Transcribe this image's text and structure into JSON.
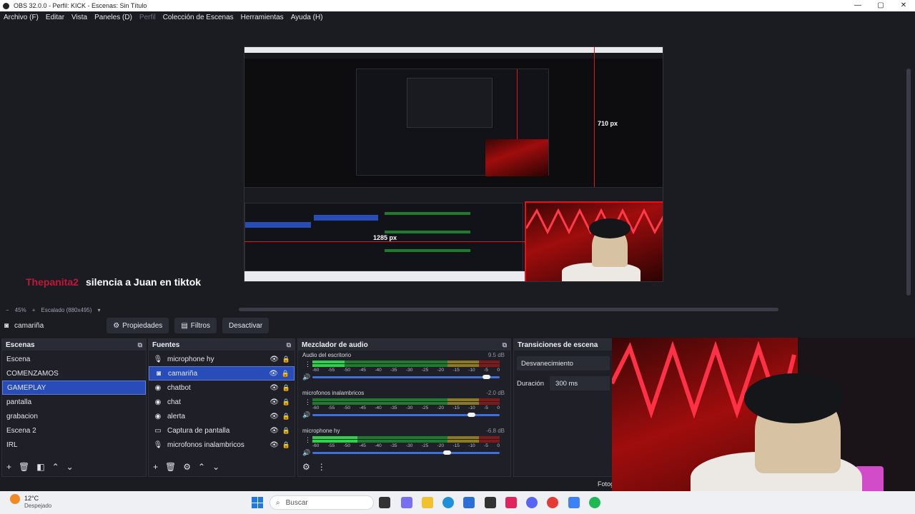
{
  "window": {
    "title": "OBS 32.0.0 - Perfil: KICK - Escenas: Sin Título",
    "controls": [
      "—",
      "▢",
      "✕"
    ]
  },
  "menu": [
    {
      "label": "Archivo (F)",
      "disabled": false
    },
    {
      "label": "Editar",
      "disabled": false
    },
    {
      "label": "Vista",
      "disabled": false
    },
    {
      "label": "Paneles (D)",
      "disabled": false
    },
    {
      "label": "Perfil",
      "disabled": true
    },
    {
      "label": "Colección de Escenas",
      "disabled": false
    },
    {
      "label": "Herramientas",
      "disabled": false
    },
    {
      "label": "Ayuda (H)",
      "disabled": false
    }
  ],
  "preview": {
    "caption_user": "Thepanita2",
    "caption_msg": "silencia a Juan en tiktok",
    "height_label": "710 px",
    "width_label": "1285 px"
  },
  "zoom": {
    "minus": "−",
    "percent": "45%",
    "plus": "+",
    "scale": "Escalado (880x495)"
  },
  "source_toolbar": {
    "selected_source": "camariña",
    "properties": "Propiedades",
    "filters": "Filtros",
    "deactivate": "Desactivar"
  },
  "scenes": {
    "title": "Escenas",
    "items": [
      "Escena",
      "COMENZAMOS",
      "GAMEPLAY",
      "pantalla",
      "grabacion",
      "Escena 2",
      "IRL"
    ],
    "selected": "GAMEPLAY"
  },
  "sources": {
    "title": "Fuentes",
    "items": [
      {
        "name": "microphone hy",
        "icon": "mic-icon"
      },
      {
        "name": "camariña",
        "icon": "camera-icon"
      },
      {
        "name": "chatbot",
        "icon": "browser-icon"
      },
      {
        "name": "chat",
        "icon": "browser-icon"
      },
      {
        "name": "alerta",
        "icon": "browser-icon"
      },
      {
        "name": "Captura de pantalla",
        "icon": "monitor-icon"
      },
      {
        "name": "microfonos inalambricos",
        "icon": "mic-icon"
      }
    ],
    "selected": "camariña"
  },
  "mixer": {
    "title": "Mezclador de audio",
    "ticks": [
      "-60",
      "-55",
      "-50",
      "-45",
      "-40",
      "-35",
      "-30",
      "-25",
      "-20",
      "-15",
      "-10",
      "-5",
      "0"
    ],
    "channels": [
      {
        "name": "Audio del escritorio",
        "db": "9.5 dB",
        "level": 0.17,
        "volume": 0.93
      },
      {
        "name": "microfonos inalambricos",
        "db": "-2.0 dB",
        "level": 0.0,
        "volume": 0.85
      },
      {
        "name": "microphone hy",
        "db": "-6.8 dB",
        "level": 0.24,
        "volume": 0.72
      }
    ]
  },
  "transitions": {
    "title": "Transiciones de escena",
    "selected": "Desvanecimiento",
    "duration_label": "Duración",
    "duration_value": "300 ms"
  },
  "status": {
    "fotog": "Fotog"
  },
  "taskbar": {
    "weather_temp": "12°C",
    "weather_desc": "Despejado",
    "search_placeholder": "Buscar"
  }
}
